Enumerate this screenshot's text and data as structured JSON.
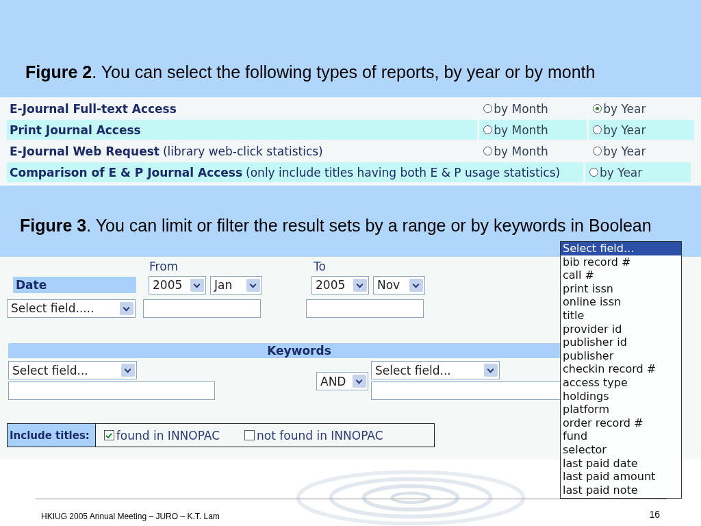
{
  "figure2_caption": "**Figure 2**. You can select the following types of reports, by year or by month",
  "reports": [
    {
      "name": "E-Journal Full-text Access",
      "shaded": false,
      "options": [
        {
          "label": "by Month",
          "selected": false
        },
        {
          "label": "by Year",
          "selected": true
        }
      ]
    },
    {
      "name": "Print Journal Access",
      "shaded": true,
      "options": [
        {
          "label": "by Month",
          "selected": false
        },
        {
          "label": "by Year",
          "selected": false
        }
      ]
    },
    {
      "name": "E-Journal Web Request",
      "note": "(library web-click statistics)",
      "shaded": false,
      "options": [
        {
          "label": "by Month",
          "selected": false
        },
        {
          "label": "by Year",
          "selected": false
        }
      ]
    },
    {
      "name": "Comparison of E & P Journal Access",
      "note": "(only include titles having both E & P usage statistics)",
      "shaded": true,
      "options": [
        {
          "label": "by Year",
          "selected": false
        }
      ]
    }
  ],
  "figure3_caption": "**Figure 3**. You can limit or filter the result sets by a range or by keywords in Boolean",
  "filter_form": {
    "from_label": "From",
    "to_label": "To",
    "date_label": "Date",
    "from_year": "2005",
    "from_month": "Jan",
    "to_year": "2005",
    "to_month": "Nov",
    "range_field": "Select field.....",
    "keywords_label": "Keywords",
    "keyword_field_left": "Select field...",
    "operator": "AND",
    "keyword_field_right": "Select field...",
    "include_label": "Include titles:",
    "include_options": [
      {
        "label": "found in INNOPAC",
        "checked": true
      },
      {
        "label": "not found in INNOPAC",
        "checked": false
      }
    ]
  },
  "field_list": [
    {
      "label": "Select field...",
      "selected": true
    },
    {
      "label": "bib record #",
      "selected": false
    },
    {
      "label": "call #",
      "selected": false
    },
    {
      "label": "print issn",
      "selected": false
    },
    {
      "label": "online issn",
      "selected": false
    },
    {
      "label": "title",
      "selected": false
    },
    {
      "label": "provider id",
      "selected": false
    },
    {
      "label": "publisher id",
      "selected": false
    },
    {
      "label": "publisher",
      "selected": false
    },
    {
      "label": "checkin record #",
      "selected": false
    },
    {
      "label": "access type",
      "selected": false
    },
    {
      "label": "holdings",
      "selected": false
    },
    {
      "label": "platform",
      "selected": false
    },
    {
      "label": "order record #",
      "selected": false
    },
    {
      "label": "fund",
      "selected": false
    },
    {
      "label": "selector",
      "selected": false
    },
    {
      "label": "last paid date",
      "selected": false
    },
    {
      "label": "last paid amount",
      "selected": false
    },
    {
      "label": "last paid note",
      "selected": false
    }
  ],
  "footer": {
    "text": "HKIUG 2005 Annual Meeting – JURO – K.T. Lam",
    "page": "16"
  }
}
